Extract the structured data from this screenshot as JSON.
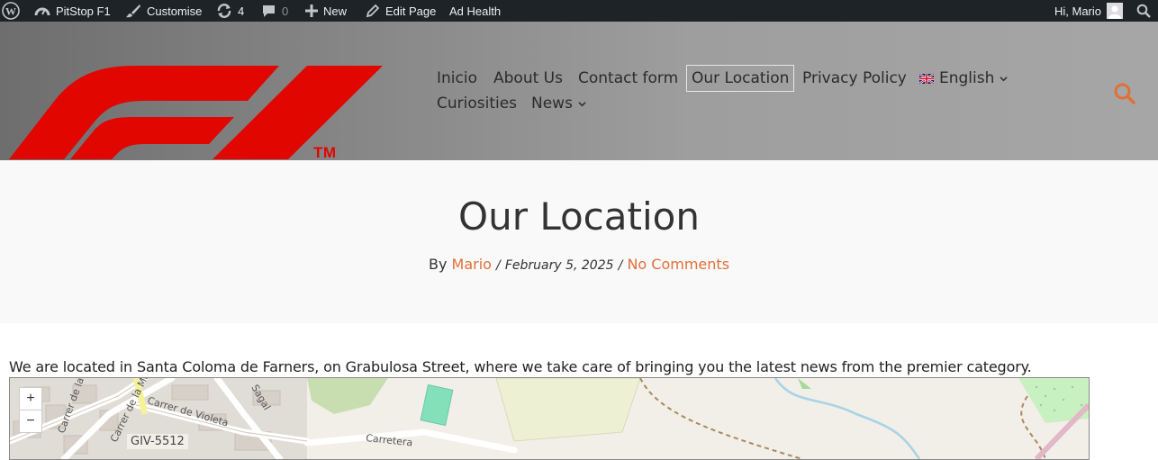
{
  "admin_bar": {
    "site_name": "PitStop F1",
    "customise": "Customise",
    "updates_count": "4",
    "comments_count": "0",
    "new": "New",
    "edit_page": "Edit Page",
    "ad_health": "Ad Health",
    "greeting": "Hi, Mario"
  },
  "header": {
    "logo_tm": "TM",
    "nav": [
      {
        "label": "Inicio"
      },
      {
        "label": "About Us"
      },
      {
        "label": "Contact form"
      },
      {
        "label": "Our Location",
        "current": true
      },
      {
        "label": "Privacy Policy"
      },
      {
        "label": "English",
        "has_flag": true,
        "dropdown": true
      },
      {
        "label": "Curiosities"
      },
      {
        "label": "News",
        "dropdown": true
      }
    ]
  },
  "post": {
    "title": "Our Location",
    "by": "By",
    "author": "Mario",
    "sep": "/",
    "date": "February 5, 2025",
    "comments": "No Comments",
    "intro": "We are located in Santa Coloma de Farners, on Grabulosa Street, where we take care of bringing you the latest news from the premier category."
  },
  "map": {
    "zoom_in": "+",
    "zoom_out": "−",
    "road_label": "GIV-5512",
    "streets": [
      "Carrer de la Rosa",
      "Carrer de Violeta",
      "Carrer de la Malva",
      "Carretera",
      "Sagal"
    ]
  },
  "colors": {
    "accent": "#e07038",
    "f1_red": "#e10600",
    "admin_bg": "#1d2327"
  }
}
